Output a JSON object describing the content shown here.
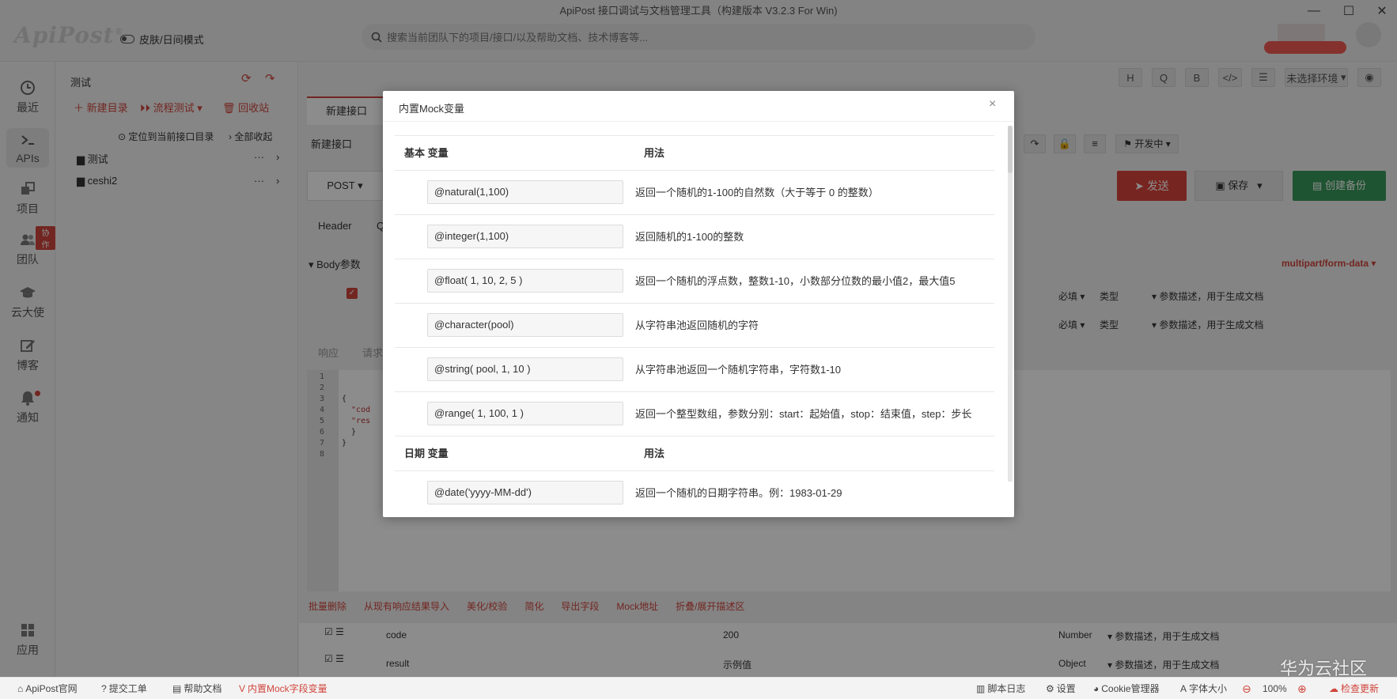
{
  "window": {
    "title": "ApiPost 接口调试与文档管理工具（构建版本 V3.2.3 For Win)"
  },
  "header": {
    "logo": "ApiPost",
    "logo_mark": "®",
    "skin_label": "皮肤/日间模式",
    "search_placeholder": "搜索当前团队下的项目/接口/以及帮助文档、技术博客等..."
  },
  "nav": [
    {
      "label": "最近",
      "icon": "clock-icon"
    },
    {
      "label": "APIs",
      "icon": "terminal-icon"
    },
    {
      "label": "项目",
      "icon": "project-icon"
    },
    {
      "label": "团队",
      "icon": "team-icon",
      "badge": "协作"
    },
    {
      "label": "云大使",
      "icon": "graduation-cap-icon"
    },
    {
      "label": "博客",
      "icon": "edit-icon"
    },
    {
      "label": "通知",
      "icon": "bell-icon"
    },
    {
      "label": "应用",
      "icon": "apps-grid-icon"
    }
  ],
  "tree": {
    "title": "测试",
    "actions": {
      "new_dir": "新建目录",
      "flow_test": "流程测试",
      "recycle": "回收站"
    },
    "locate": "定位到当前接口目录",
    "collapse": "全部收起",
    "items": [
      "测试",
      "ceshi2"
    ]
  },
  "main": {
    "tab": "新建接口",
    "api_name": "新建接口",
    "method": "POST",
    "send": "发送",
    "save": "保存",
    "backup": "创建备份",
    "env": "未选择环境",
    "status": "开发中",
    "toolbar_letters": [
      "H",
      "Q",
      "B"
    ],
    "request_tabs": [
      "Header",
      "Q"
    ],
    "body_label": "Body参数",
    "content_type": "multipart/form-data",
    "param_required": "必填",
    "param_type": "类型",
    "param_desc": "参数描述，用于生成文档",
    "resp_tabs": [
      "响应",
      "请求"
    ],
    "line_numbers": [
      "1",
      "2",
      "3",
      "4",
      "5",
      "6",
      "7",
      "8"
    ],
    "code_lines": [
      "{",
      "  \"cod",
      "  \"res",
      "",
      "",
      "",
      "  }",
      "}"
    ],
    "bottom_actions": [
      "批量删除",
      "从现有响应结果导入",
      "美化/校验",
      "简化",
      "导出字段",
      "Mock地址",
      "折叠/展开描述区"
    ],
    "resp_rows": [
      {
        "name": "code",
        "value": "200",
        "type": "Number",
        "desc": "参数描述，用于生成文档"
      },
      {
        "name": "result",
        "value": "示例值",
        "type": "Object",
        "desc": "参数描述，用于生成文档"
      }
    ]
  },
  "modal": {
    "title": "内置Mock变量",
    "close": "×",
    "sections": [
      {
        "title": "基本 变量",
        "usage": "用法",
        "rows": [
          {
            "code": "@natural(1,100)",
            "desc": "返回一个随机的1-100的自然数（大于等于 0 的整数）"
          },
          {
            "code": "@integer(1,100)",
            "desc": "返回随机的1-100的整数"
          },
          {
            "code": "@float( 1, 10, 2, 5 )",
            "desc": "返回一个随机的浮点数，整数1-10，小数部分位数的最小值2，最大值5"
          },
          {
            "code": "@character(pool)",
            "desc": "从字符串池返回随机的字符"
          },
          {
            "code": "@string( pool, 1, 10 )",
            "desc": "从字符串池返回一个随机字符串，字符数1-10"
          },
          {
            "code": "@range( 1, 100, 1 )",
            "desc": "返回一个整型数组，参数分别：start：起始值，stop：结束值，step：步长"
          }
        ]
      },
      {
        "title": "日期 变量",
        "usage": "用法",
        "rows": [
          {
            "code": "@date('yyyy-MM-dd')",
            "desc": "返回一个随机的日期字符串。例：1983-01-29"
          }
        ]
      }
    ]
  },
  "statusbar": {
    "left": [
      "ApiPost官网",
      "提交工单",
      "帮助文档",
      "内置Mock字段变量"
    ],
    "right": [
      "脚本日志",
      "设置",
      "Cookie管理器",
      "字体大小",
      "100%",
      "检查更新"
    ],
    "watermark": "华为云社区"
  },
  "colors": {
    "accent": "#d0453c",
    "send": "#d9443b",
    "backup": "#3a9a5b"
  }
}
